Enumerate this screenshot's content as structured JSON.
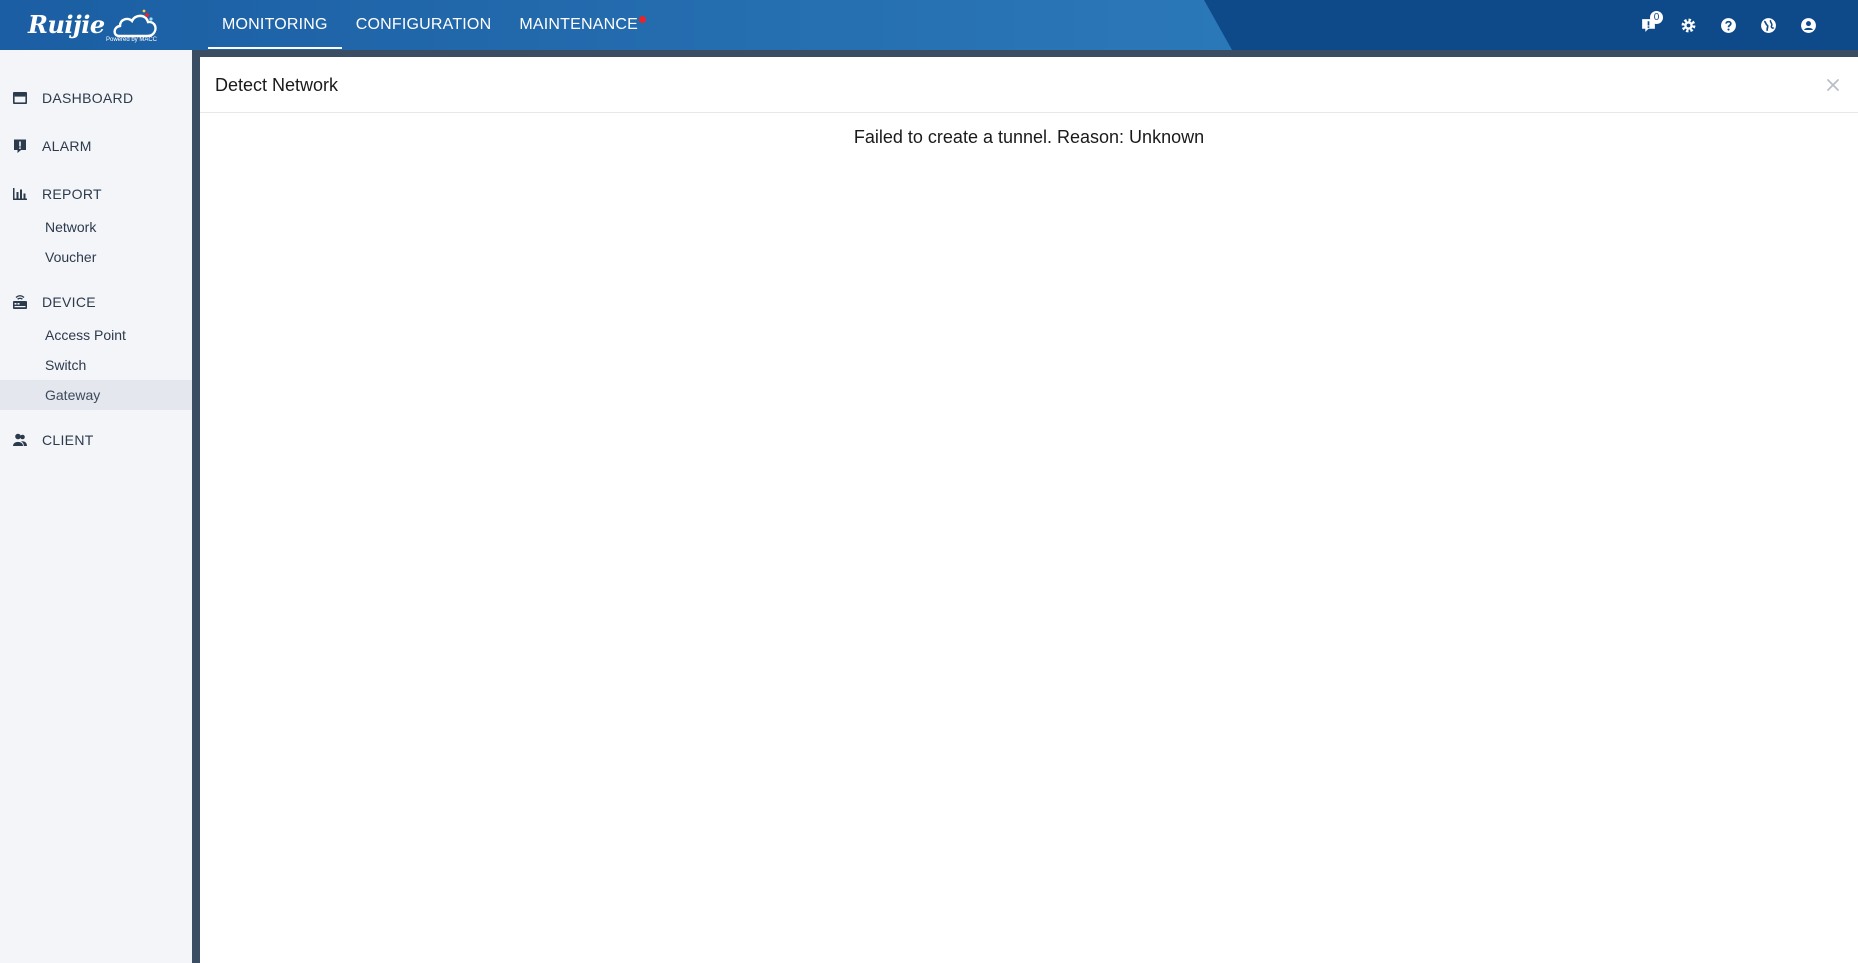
{
  "brand": {
    "logo_text": "Ruijie",
    "logo_sub": "Powered by MACC"
  },
  "nav": {
    "tabs": [
      {
        "label": "MONITORING",
        "active": true
      },
      {
        "label": "CONFIGURATION",
        "active": false
      },
      {
        "label": "MAINTENANCE",
        "active": false,
        "has_alert_dot": true
      }
    ]
  },
  "toolbar": {
    "notifications_icon": "notification-icon",
    "notifications_count": "0",
    "settings_icon": "gear-icon",
    "help_icon": "help-icon",
    "language_icon": "globe-icon",
    "account_icon": "user-icon"
  },
  "sidebar": {
    "sections": [
      {
        "label": "DASHBOARD",
        "icon": "dashboard-icon",
        "items": []
      },
      {
        "label": "ALARM",
        "icon": "alarm-icon",
        "items": []
      },
      {
        "label": "REPORT",
        "icon": "bar-chart-icon",
        "items": [
          "Network",
          "Voucher"
        ]
      },
      {
        "label": "DEVICE",
        "icon": "device-icon",
        "items": [
          "Access Point",
          "Switch",
          "Gateway"
        ]
      },
      {
        "label": "CLIENT",
        "icon": "client-icon",
        "items": []
      }
    ],
    "active_item": "Gateway"
  },
  "panel": {
    "title": "Detect Network",
    "message": "Failed to create a tunnel. Reason: Unknown",
    "close_icon": "close-icon"
  },
  "colors": {
    "topbar": "#0e4a8a",
    "topbar_gradient": "#2a73b3",
    "rail": "#3a4d63",
    "sidebar_bg": "#f4f5f8",
    "alert_dot": "#e8242a"
  }
}
